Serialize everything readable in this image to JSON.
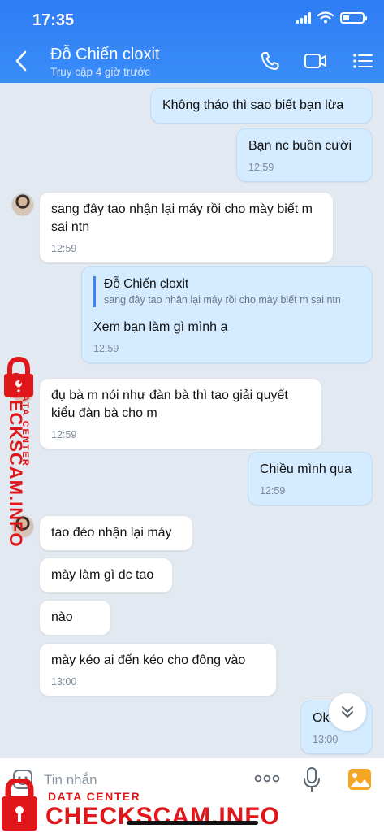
{
  "status_bar": {
    "time": "17:35",
    "battery_level": 0.3
  },
  "header": {
    "title": "Đỗ Chiến cloxit",
    "subtitle": "Truy cập 4 giờ trước",
    "icons": [
      "back-arrow-icon",
      "phone-icon",
      "video-call-icon",
      "menu-list-icon"
    ]
  },
  "messages": [
    {
      "dir": "out",
      "text": "Không tháo thì sao biết bạn lừa",
      "time": ""
    },
    {
      "dir": "out",
      "text": "Bạn nc buồn cười",
      "time": "12:59"
    },
    {
      "dir": "in",
      "text": "sang đây tao nhận lại máy rồi cho mày biết m sai ntn",
      "time": "12:59"
    },
    {
      "dir": "out",
      "quote_name": "Đỗ Chiến cloxit",
      "quote_text": "sang đây tao nhận lại máy rồi cho mày biết m sai ntn",
      "text": "Xem bạn làm gì mình ạ",
      "time": "12:59"
    },
    {
      "dir": "in",
      "text": "đụ bà m nói như đàn bà thì tao giải quyết kiểu đàn bà cho m",
      "time": "12:59"
    },
    {
      "dir": "out",
      "text": "Chiều mình qua",
      "time": "12:59"
    },
    {
      "dir": "in",
      "text": "tao đéo nhận lại máy",
      "time": ""
    },
    {
      "dir": "in",
      "text": "mày làm gì dc tao",
      "time": ""
    },
    {
      "dir": "in",
      "text": "nào",
      "time": ""
    },
    {
      "dir": "in",
      "text": "mày kéo ai đến kéo cho đông vào",
      "time": "13:00"
    },
    {
      "dir": "out",
      "text": "Ok",
      "time": "13:00"
    }
  ],
  "input": {
    "placeholder": "Tin nhắn"
  },
  "watermark": {
    "side_title": "CHECKSCAM.INFO",
    "side_subtitle": "DATA CENTER",
    "bottom_subtitle": "DATA CENTER",
    "bottom_title": "CHECKSCAM.INFO",
    "color": "#e0161b"
  },
  "colors": {
    "header": "#2f7cf6",
    "outgoing_bubble": "#d5ebff",
    "incoming_bubble": "#ffffff",
    "background": "#e2e9f1"
  }
}
